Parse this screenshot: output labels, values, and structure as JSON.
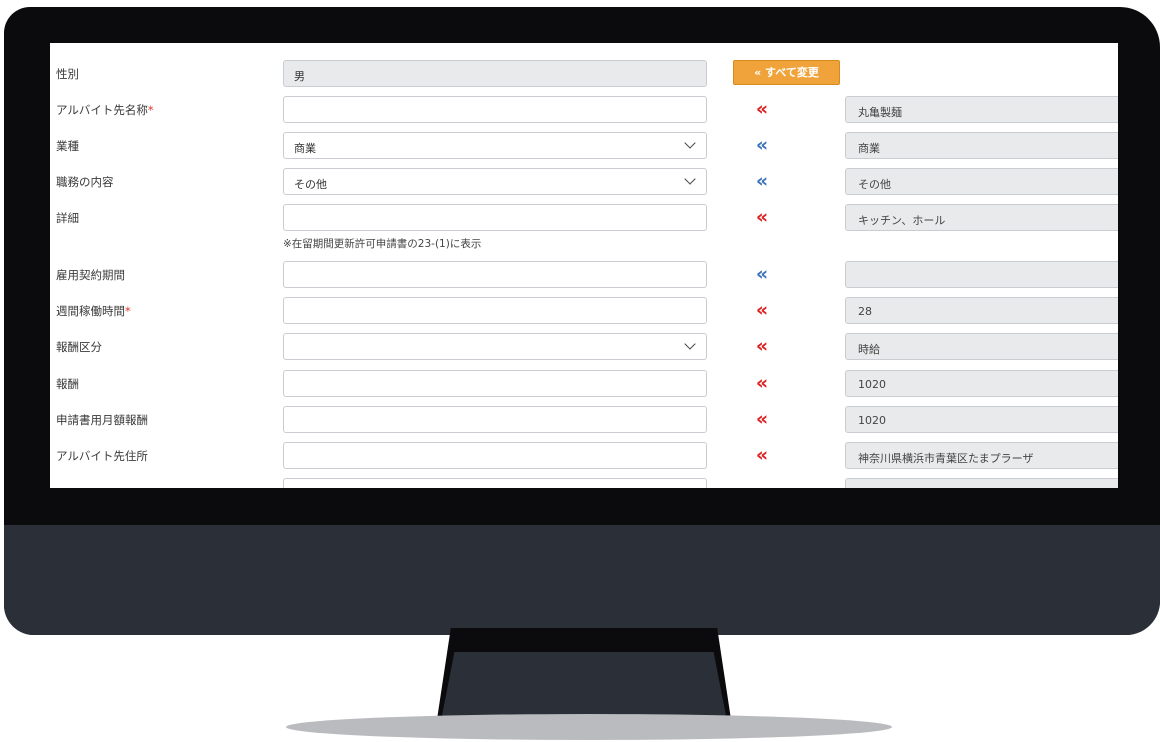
{
  "toolbar": {
    "change_all_label": "« すべて変更"
  },
  "note": "※在留期間更新許可申請書の23-(1)に表示",
  "rows": [
    {
      "label": "性別",
      "required": "",
      "value": "男",
      "arrow": "",
      "original": ""
    },
    {
      "label": "アルバイト先名称",
      "required": "*",
      "value": "",
      "arrow": "«",
      "arrow_color": "red",
      "original": "丸亀製麺"
    },
    {
      "label": "業種",
      "required": "",
      "value": "商業",
      "arrow": "«",
      "arrow_color": "blue",
      "original": "商業"
    },
    {
      "label": "職務の内容",
      "required": "",
      "value": "その他",
      "arrow": "«",
      "arrow_color": "blue",
      "original": "その他"
    },
    {
      "label": "詳細",
      "required": "",
      "value": "",
      "arrow": "«",
      "arrow_color": "red",
      "original": "キッチン、ホール"
    },
    {
      "label": "雇用契約期間",
      "required": "",
      "value": "",
      "arrow": "«",
      "arrow_color": "blue",
      "original": ""
    },
    {
      "label": "週間稼働時間",
      "required": "*",
      "value": "",
      "arrow": "«",
      "arrow_color": "red",
      "original": "28"
    },
    {
      "label": "報酬区分",
      "required": "",
      "value": "",
      "arrow": "«",
      "arrow_color": "red",
      "original": "時給"
    },
    {
      "label": "報酬",
      "required": "",
      "value": "",
      "arrow": "«",
      "arrow_color": "red",
      "original": "1020"
    },
    {
      "label": "申請書用月額報酬",
      "required": "",
      "value": "",
      "arrow": "«",
      "arrow_color": "red",
      "original": "1020"
    },
    {
      "label": "アルバイト先住所",
      "required": "",
      "value": "",
      "arrow": "«",
      "arrow_color": "red",
      "original": "神奈川県横浜市青葉区たまプラーザ"
    }
  ],
  "colors": {
    "accent_orange": "#f0a33a",
    "arrow_red": "#e02020",
    "arrow_blue": "#3a73b8",
    "monitor_body": "#2a2f38"
  }
}
